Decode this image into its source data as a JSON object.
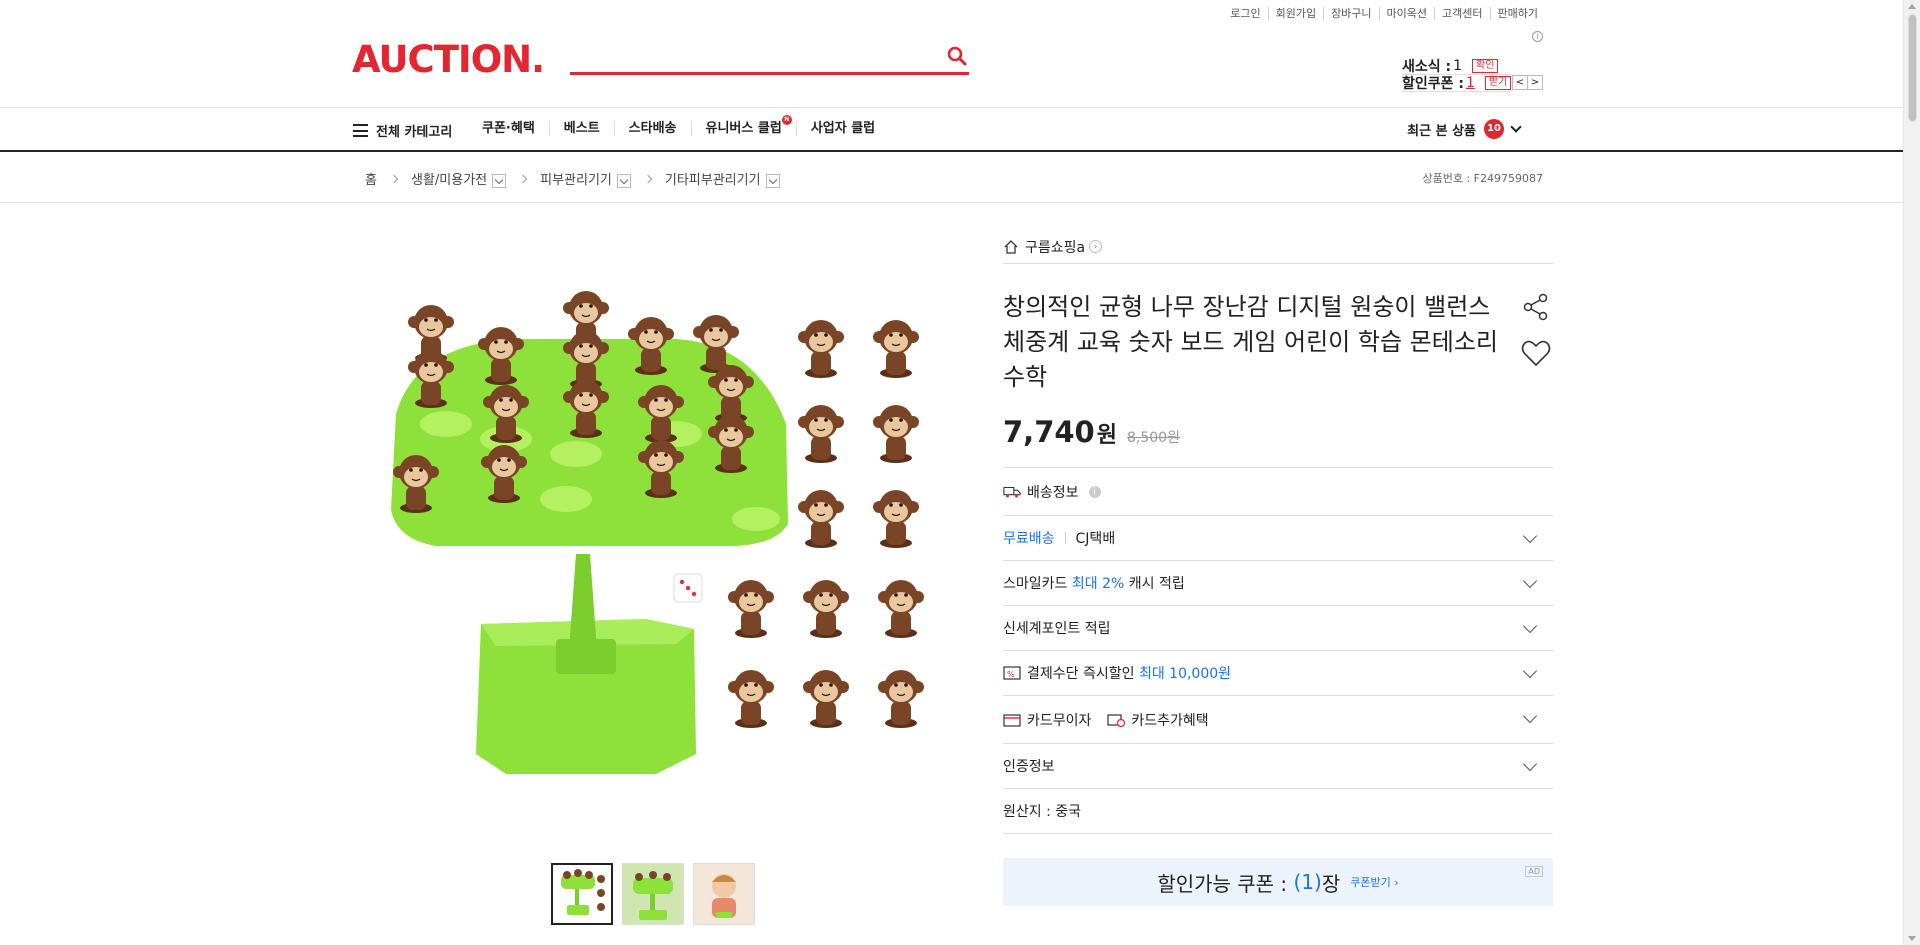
{
  "util_links": [
    "로그인",
    "회원가입",
    "장바구니",
    "마이옥션",
    "고객센터",
    "판매하기"
  ],
  "logo": "AUCTION.",
  "search": {
    "placeholder": ""
  },
  "mini": {
    "new_msg_label": "새소식 :",
    "new_msg_value": "1",
    "new_msg_action": "확인",
    "coupon_label": "할인쿠폰 :",
    "coupon_value": "1",
    "coupon_action": "받기",
    "prev": "<",
    "next": ">"
  },
  "nav": {
    "all_categories": "전체 카테고리",
    "menu": [
      "쿠폰·혜택",
      "베스트",
      "스타배송",
      "유니버스 클럽",
      "사업자 클럽"
    ],
    "new_badge": "N",
    "recent_label": "최근 본 상품",
    "recent_count": "10"
  },
  "breadcrumb": {
    "items": [
      "홈",
      "생활/미용가전",
      "피부관리기기",
      "기타피부관리기기"
    ],
    "product_no": "상품번호 : F249759087"
  },
  "product": {
    "seller": "구름쇼핑a",
    "title": "창의적인 균형 나무 장난감 디지털 원숭이 밸런스 체중계 교육 숫자 보드 게임 어린이 학습 몬테소리 수학",
    "price": "7,740",
    "price_unit": "원",
    "original_price": "8,500원",
    "shipping_label": "배송정보",
    "free_shipping": "무료배송",
    "courier": "CJ택배",
    "smile_card_a": "스마일카드",
    "smile_card_b": "최대 2%",
    "smile_card_c": "캐시 적립",
    "ssg_point": "신세계포인트 적립",
    "pay_discount_a": "결제수단 즉시할인",
    "pay_discount_b": "최대 10,000원",
    "card_no_interest": "카드무이자",
    "card_extra": "카드추가혜택",
    "certification": "인증정보",
    "origin": "원산지 : 중국"
  },
  "coupon": {
    "label": "할인가능 쿠폰 :",
    "count": "(1)",
    "unit": "장",
    "get": "쿠폰받기 ›",
    "ad": "AD"
  },
  "colors": {
    "brand": "#e3262f",
    "link": "#1a73e8",
    "tree_green": "#8ee03a",
    "monkey_brown": "#7a4526"
  }
}
